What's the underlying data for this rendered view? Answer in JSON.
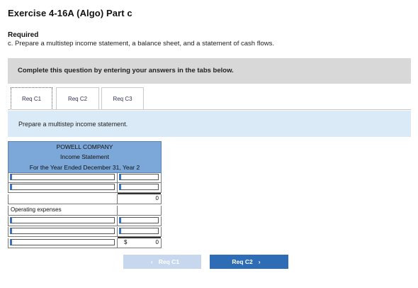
{
  "exercise": {
    "title": "Exercise 4-16A (Algo) Part c",
    "required_heading": "Required",
    "required_text": "c. Prepare a multistep income statement, a balance sheet, and a statement of cash flows."
  },
  "banner": {
    "text": "Complete this question by entering your answers in the tabs below."
  },
  "tabs": [
    {
      "label": "Req C1",
      "active": true
    },
    {
      "label": "Req C2",
      "active": false
    },
    {
      "label": "Req C3",
      "active": false
    }
  ],
  "instruction": "Prepare a multistep income statement.",
  "statement": {
    "company": "POWELL COMPANY",
    "name": "Income Statement",
    "period": "For the Year Ended December 31, Year 2",
    "rows": [
      {
        "label": "",
        "value": ""
      },
      {
        "label": "",
        "value": ""
      },
      {
        "label": "",
        "value": "0"
      },
      {
        "label": "Operating expenses",
        "value": ""
      },
      {
        "label": "",
        "value": ""
      },
      {
        "label": "",
        "value": ""
      },
      {
        "label": "",
        "currency": "$",
        "value": "0"
      }
    ]
  },
  "nav": {
    "prev_label": "Req C1",
    "next_label": "Req C2",
    "prev_chevron": "‹",
    "next_chevron": "›"
  }
}
